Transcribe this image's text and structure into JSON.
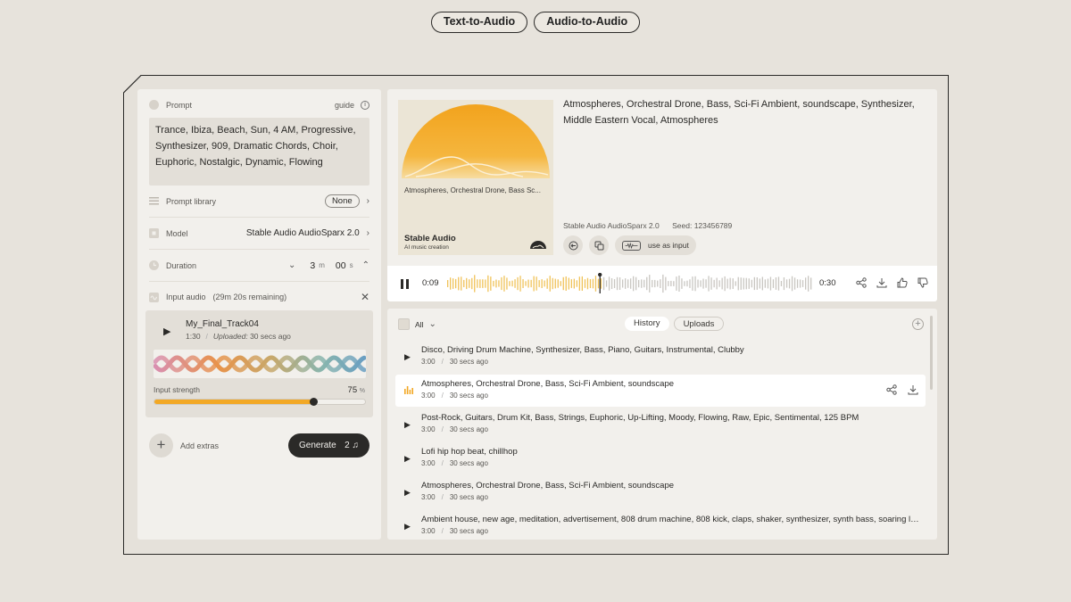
{
  "mode_tabs": [
    "Text-to-Audio",
    "Audio-to-Audio"
  ],
  "left": {
    "prompt_label": "Prompt",
    "guide_label": "guide",
    "prompt_text": "Trance, Ibiza, Beach, Sun, 4 AM, Progressive, Synthesizer, 909, Dramatic Chords, Choir, Euphoric, Nostalgic, Dynamic, Flowing",
    "prompt_library_label": "Prompt library",
    "prompt_library_value": "None",
    "model_label": "Model",
    "model_value": "Stable Audio AudioSparx 2.0",
    "duration_label": "Duration",
    "duration_min": "3",
    "duration_min_unit": "m",
    "duration_sec": "00",
    "duration_sec_unit": "s",
    "input_audio_label": "Input audio",
    "input_audio_remaining": "(29m 20s remaining)",
    "input_track_name": "My_Final_Track04",
    "input_track_length": "1:30",
    "input_track_uploaded_label": "Uploaded:",
    "input_track_uploaded_value": "30 secs ago",
    "input_strength_label": "Input strength",
    "input_strength_value": "75",
    "input_strength_unit": "%",
    "input_strength_fraction": 0.75,
    "add_extras_label": "Add extras",
    "generate_label": "Generate",
    "generate_count": "2"
  },
  "player": {
    "art_caption": "Atmospheres, Orchestral Drone, Bass Sc...",
    "art_brand": "Stable Audio",
    "art_sub": "AI music creation",
    "title": "Atmospheres, Orchestral Drone, Bass, Sci-Fi Ambient, soundscape, Synthesizer, Middle Eastern Vocal, Atmospheres",
    "model": "Stable Audio AudioSparx 2.0",
    "seed": "Seed: 123456789",
    "use_as_input_label": "use as input",
    "time_current": "0:09",
    "time_total": "0:30",
    "progress_fraction": 0.42
  },
  "history": {
    "filter_label": "All",
    "tabs": [
      "History",
      "Uploads"
    ],
    "active_tab": "History",
    "items": [
      {
        "title": "Disco, Driving Drum Machine, Synthesizer, Bass, Piano, Guitars, Instrumental, Clubby",
        "duration": "3:00",
        "age": "30 secs ago"
      },
      {
        "title": "Atmospheres, Orchestral Drone, Bass, Sci-Fi Ambient, soundscape",
        "duration": "3:00",
        "age": "30 secs ago",
        "selected": true
      },
      {
        "title": "Post-Rock, Guitars, Drum Kit, Bass, Strings, Euphoric, Up-Lifting, Moody, Flowing, Raw, Epic, Sentimental, 125 BPM",
        "duration": "3:00",
        "age": "30 secs ago"
      },
      {
        "title": "Lofi hip hop beat, chillhop",
        "duration": "3:00",
        "age": "30 secs ago"
      },
      {
        "title": "Atmospheres, Orchestral Drone, Bass, Sci-Fi Ambient, soundscape",
        "duration": "3:00",
        "age": "30 secs ago"
      },
      {
        "title": "Ambient house, new age, meditation, advertisement, 808 drum machine, 808 kick, claps, shaker, synthesizer, synth bass, soaring lea...",
        "duration": "3:00",
        "age": "30 secs ago"
      }
    ]
  },
  "colors": {
    "accent": "#f2a825",
    "dark": "#2b2a28",
    "background": "#e7e3dc",
    "panel": "#f2f0ec"
  },
  "icons": [
    "info-icon",
    "prompt-library-icon",
    "model-icon",
    "duration-icon",
    "input-audio-icon",
    "close-icon",
    "play-icon",
    "pause-icon",
    "plus-icon",
    "music-note-icon",
    "share-icon",
    "download-icon",
    "thumbs-up-icon",
    "thumbs-down-icon",
    "chevron-down-icon",
    "chevron-up-icon",
    "chevron-right-icon",
    "equalizer-icon"
  ]
}
